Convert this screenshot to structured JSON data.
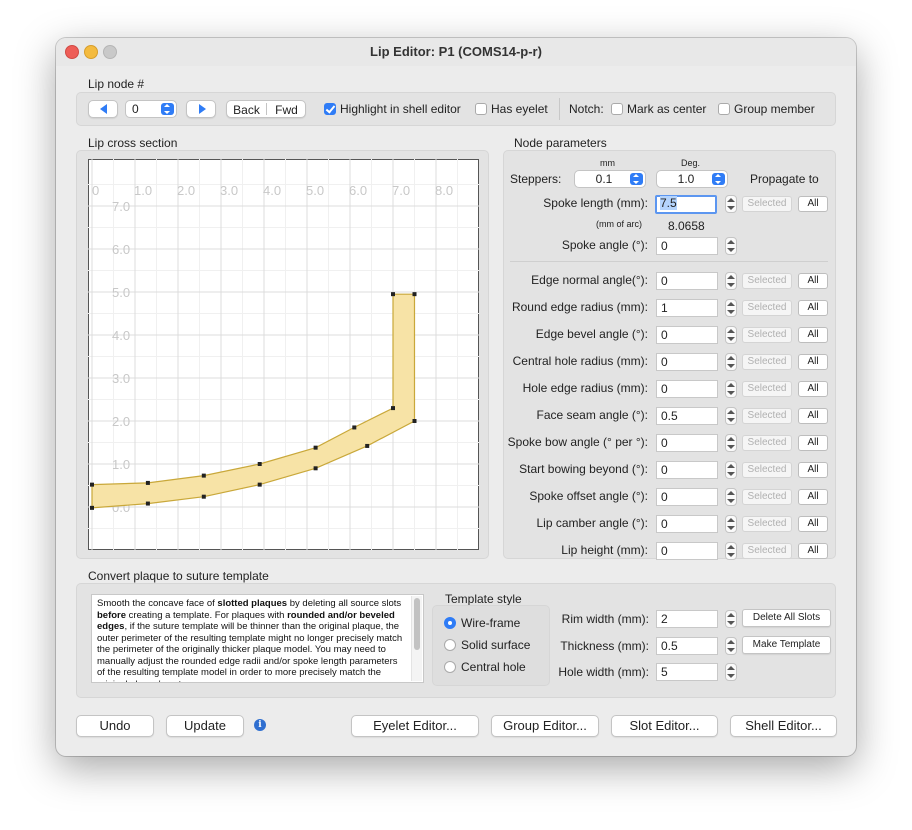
{
  "window": {
    "title": "Lip Editor: P1 (COMS14-p-r)",
    "traffic_colors": {
      "close": "#ee5d57",
      "minimize": "#f4bb3f",
      "zoom": "#c9c9c9"
    }
  },
  "lip_node": {
    "section_label": "Lip node #",
    "node_value": "0",
    "back_label": "Back",
    "fwd_label": "Fwd",
    "highlight_label": "Highlight in shell editor",
    "highlight_checked": true,
    "has_eyelet_label": "Has eyelet",
    "notch_label": "Notch:",
    "mark_center_label": "Mark as center",
    "group_member_label": "Group member"
  },
  "cross_section": {
    "section_label": "Lip cross section",
    "x_ticks": [
      "0",
      "1.0",
      "2.0",
      "3.0",
      "4.0",
      "5.0",
      "6.0",
      "7.0",
      "8.0"
    ],
    "y_ticks": [
      "7.0",
      "6.0",
      "5.0",
      "4.0",
      "3.0",
      "2.0",
      "1.0",
      "0.0"
    ],
    "fill_color": "#f7e3a6",
    "stroke_color": "#c9a83a"
  },
  "node_params": {
    "section_label": "Node parameters",
    "mm_label": "mm",
    "deg_label": "Deg.",
    "steppers_label": "Steppers:",
    "mm_value": "0.1",
    "deg_value": "1.0",
    "propagate_label": "Propagate to",
    "spoke_length_label": "Spoke length (mm):",
    "spoke_length_value": "7.5",
    "mm_of_arc_label": "(mm of arc)",
    "mm_of_arc_value": "8.0658",
    "spoke_angle_label": "Spoke angle (°):",
    "spoke_angle_value": "0",
    "selected_label": "Selected",
    "all_label": "All",
    "rows": [
      {
        "label": "Edge normal angle(°):",
        "value": "0"
      },
      {
        "label": "Round edge radius (mm):",
        "value": "1"
      },
      {
        "label": "Edge bevel angle (°):",
        "value": "0"
      },
      {
        "label": "Central hole radius (mm):",
        "value": "0"
      },
      {
        "label": "Hole edge radius (mm):",
        "value": "0"
      },
      {
        "label": "Face seam angle (°):",
        "value": "0.5"
      },
      {
        "label": "Spoke bow angle (° per °):",
        "value": "0"
      },
      {
        "label": "Start bowing beyond (°):",
        "value": "0"
      },
      {
        "label": "Spoke offset angle (°):",
        "value": "0"
      },
      {
        "label": "Lip camber angle (°):",
        "value": "0"
      },
      {
        "label": "Lip height (mm):",
        "value": "0"
      }
    ]
  },
  "convert": {
    "section_label": "Convert plaque to suture template",
    "description_parts": [
      {
        "t": "Smooth the concave face of ",
        "b": false
      },
      {
        "t": "slotted plaques",
        "b": true
      },
      {
        "t": " by deleting all source slots ",
        "b": false
      },
      {
        "t": "before",
        "b": true
      },
      {
        "t": " creating a template. For plaques with ",
        "b": false
      },
      {
        "t": "rounded and/or beveled edges",
        "b": true
      },
      {
        "t": ", if the suture template will be thinner than the original plaque, the outer perimeter of the resulting template might no longer precisely match the perimeter of the originally thicker plaque model. You may need to manually adjust the rounded edge radii and/or spoke length parameters of the resulting template model in order to more precisely match the original plaque's outer",
        "b": false
      }
    ],
    "template_style_label": "Template style",
    "styles": [
      {
        "label": "Wire-frame",
        "selected": true
      },
      {
        "label": "Solid surface",
        "selected": false
      },
      {
        "label": "Central hole",
        "selected": false
      }
    ],
    "rim_width_label": "Rim width (mm):",
    "rim_width_value": "2",
    "thickness_label": "Thickness (mm):",
    "thickness_value": "0.5",
    "hole_width_label": "Hole width (mm):",
    "hole_width_value": "5",
    "delete_slots_label": "Delete All Slots",
    "make_template_label": "Make Template"
  },
  "footer": {
    "undo_label": "Undo",
    "update_label": "Update",
    "info_glyph": "i",
    "eyelet_label": "Eyelet Editor...",
    "group_label": "Group Editor...",
    "slot_label": "Slot Editor...",
    "shell_label": "Shell Editor..."
  }
}
